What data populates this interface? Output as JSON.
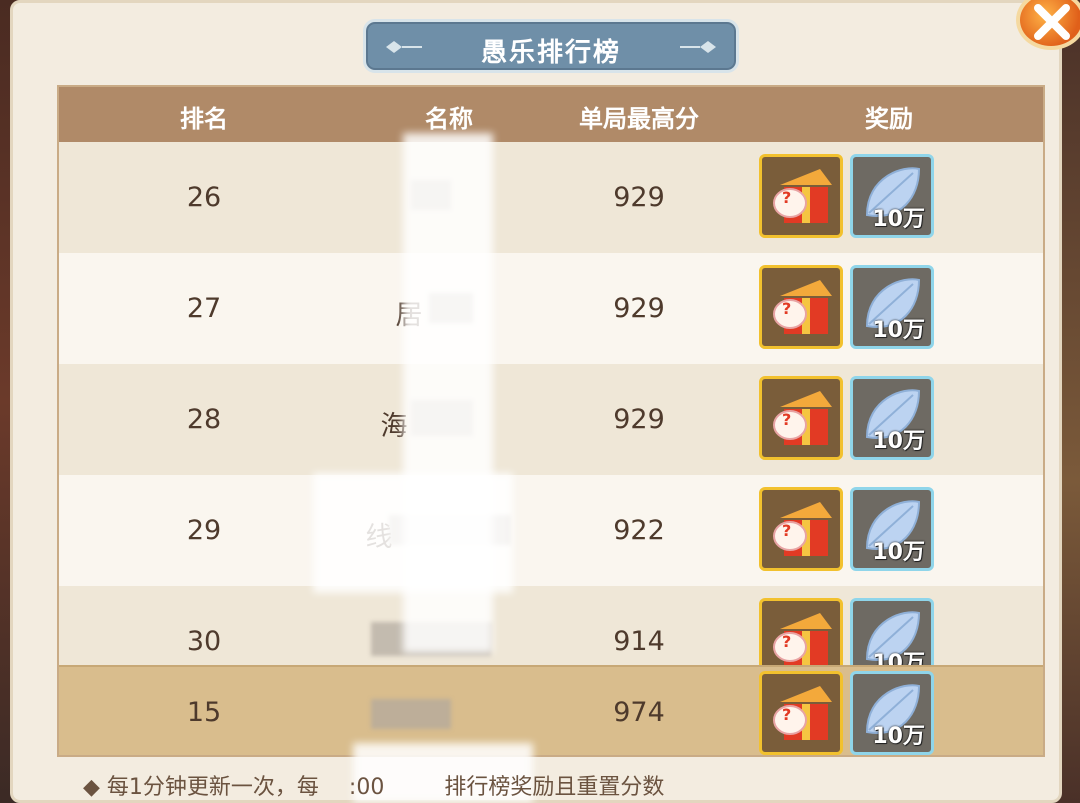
{
  "title": "愚乐排行榜",
  "headers": {
    "rank": "排名",
    "name": "名称",
    "score": "单局最高分",
    "reward": "奖励"
  },
  "rows": [
    {
      "rank": "26",
      "name": "",
      "score": "929",
      "leaf": "10万"
    },
    {
      "rank": "27",
      "name": "居",
      "score": "929",
      "leaf": "10万"
    },
    {
      "rank": "28",
      "name": "海",
      "score": "929",
      "leaf": "10万"
    },
    {
      "rank": "29",
      "name": "线",
      "score": "922",
      "leaf": "10万"
    },
    {
      "rank": "30",
      "name": "",
      "score": "914",
      "leaf": "10万"
    }
  ],
  "my_row": {
    "rank": "15",
    "name": "",
    "score": "974",
    "leaf": "10万"
  },
  "footer": {
    "part1": "◆ 每1分钟更新一次，每",
    "part2": ":00",
    "part3": "排行榜奖励且重置分数"
  },
  "colors": {
    "header": "#b08a68",
    "gift_border": "#f2c12e",
    "leaf_border": "#8fd5ea",
    "banner": "#6f8fa8"
  }
}
